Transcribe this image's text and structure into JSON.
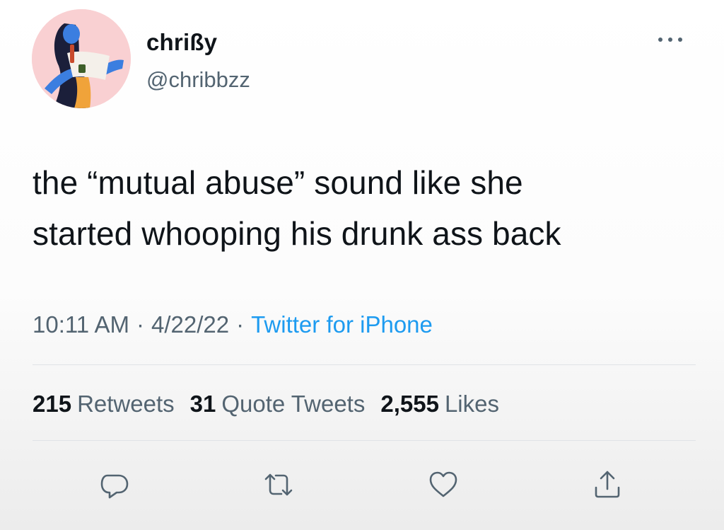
{
  "tweet": {
    "author": {
      "display_name": "chrißy",
      "handle": "@chribbzz",
      "avatar_icon": "avatar-illustration"
    },
    "more_icon": "more-options-icon",
    "text": "the “mutual abuse” sound like she\nstarted whooping his drunk ass back",
    "meta": {
      "time": "10:11 AM",
      "separator": "·",
      "date": "4/22/22",
      "source": "Twitter for iPhone"
    },
    "stats": {
      "retweets": {
        "count": "215",
        "label": "Retweets"
      },
      "quote_tweets": {
        "count": "31",
        "label": "Quote Tweets"
      },
      "likes": {
        "count": "2,555",
        "label": "Likes"
      }
    },
    "actions": [
      "reply-icon",
      "retweet-icon",
      "like-icon",
      "share-icon"
    ]
  },
  "colors": {
    "text_primary": "#0f1419",
    "text_secondary": "#536471",
    "accent": "#1d9bf0",
    "avatar_bg": "#f9d0d2",
    "avatar_figure": "#2f6fd6"
  }
}
